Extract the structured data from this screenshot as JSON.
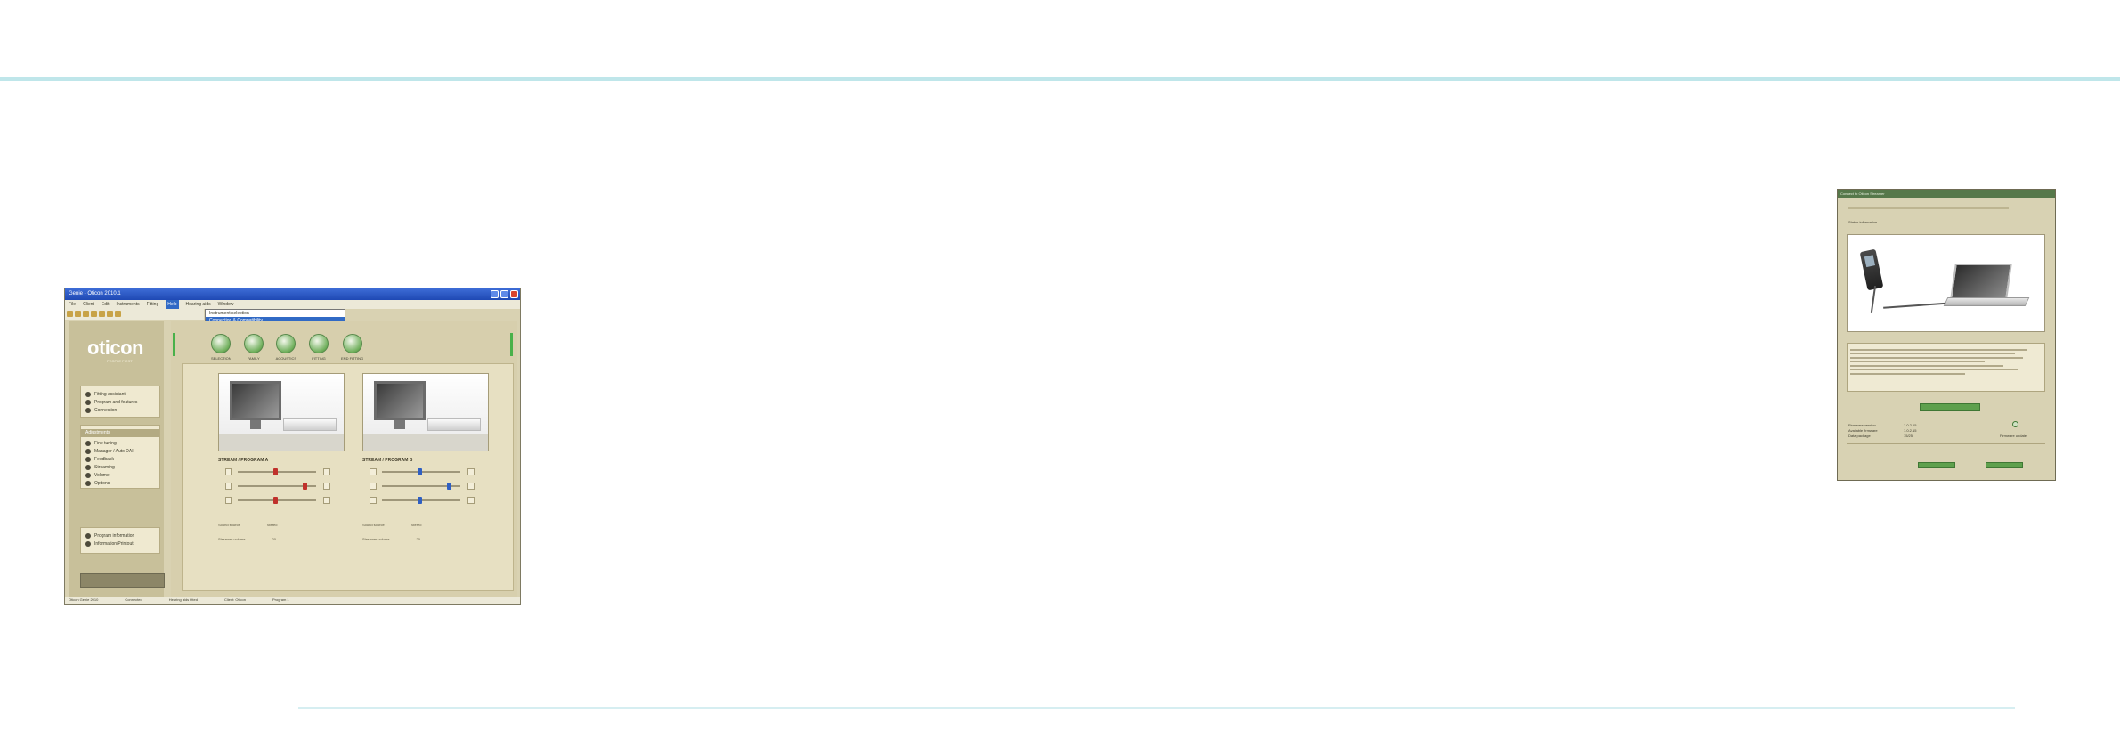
{
  "page": {
    "accent_color": "#bfe6ea"
  },
  "screenshot_left": {
    "window_title": "Genie - Oticon 2010.1",
    "menus": [
      "File",
      "Client",
      "Edit",
      "Instruments",
      "Fitting",
      "Help",
      "Hearing aids",
      "Window"
    ],
    "active_menu_index": 5,
    "dropdown_items": [
      "Instrument selection",
      "Connection & Compatibility"
    ],
    "logo": "oticon",
    "logo_sub": "PEOPLE FIRST",
    "step_labels": [
      "SELECTION",
      "FAMILY",
      "ACOUSTICS",
      "FITTING",
      "END FITTING"
    ],
    "panel_top_items": [
      "Fitting assistant",
      "Program and features",
      "Connection"
    ],
    "panel_middle_title": "Adjustments",
    "panel_middle_items": [
      "Fine tuning",
      "Manager / Auto DAI",
      "Feedback",
      "Streaming",
      "Volume",
      "Options"
    ],
    "panel_bottom_items": [
      "Program information",
      "Information/Printout"
    ],
    "sections": [
      {
        "label": "STREAM / PROGRAM A",
        "kv": [
          [
            "Sound source",
            "Stereo"
          ],
          [
            "Streamer volume",
            "20"
          ]
        ]
      },
      {
        "label": "STREAM / PROGRAM B",
        "kv": [
          [
            "Sound source",
            "Stereo"
          ],
          [
            "Streamer volume",
            "20"
          ]
        ]
      }
    ],
    "status_items": [
      "Oticon Genie 2010",
      "Connected",
      "Hearing aids fitted",
      "Client: Oticon",
      "Program 1"
    ]
  },
  "screenshot_right": {
    "window_title": "Connect to Oticon Streamer",
    "heading": "Status information",
    "button_label": "Connect",
    "info_rows": [
      [
        "Firmware version",
        "1.0.2.15"
      ],
      [
        "Available firmware",
        "1.0.2.15"
      ],
      [
        "Data package",
        "15/25"
      ]
    ],
    "side_label": "Firmware update",
    "footer_buttons": [
      "OK",
      "Cancel"
    ]
  }
}
